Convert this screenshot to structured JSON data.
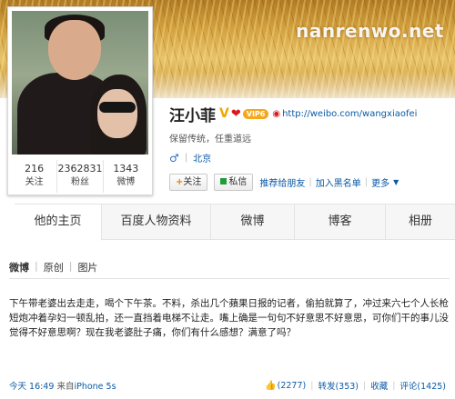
{
  "watermark": "nanrenwo.net",
  "profile": {
    "name": "汪小菲",
    "v_badge": "V",
    "heart_badge": "❤",
    "vip_badge": "VIP6",
    "weibo_url": "http://weibo.com/wangxiaofei",
    "bio": "保留传统，任重道远",
    "gender_symbol": "♂",
    "location": "北京"
  },
  "stats": [
    {
      "num": "216",
      "label": "关注"
    },
    {
      "num": "2362831",
      "label": "粉丝"
    },
    {
      "num": "1343",
      "label": "微博"
    }
  ],
  "actions": {
    "follow": "关注",
    "message": "私信",
    "recommend": "推荐给朋友",
    "blacklist": "加入黑名单",
    "more": "更多"
  },
  "tabs": [
    "他的主页",
    "百度人物资料",
    "微博",
    "博客",
    "相册"
  ],
  "subtabs": [
    "微博",
    "原创",
    "图片"
  ],
  "post": {
    "text": "下午带老婆出去走走，喝个下午茶。不料，杀出几个蘋果日报的记者，偷拍就算了，冲过来六七个人长枪短炮冲着孕妇一顿乱拍，还一直挡着电梯不让走。嘴上确是一句句不好意思不好意思，可你们干的事儿没觉得不好意思啊？现在我老婆肚子痛，你们有什么感想？满意了吗？",
    "time": "今天 16:49",
    "source_prefix": "来自",
    "source_device": "iPhone 5s",
    "likes": "(2277)",
    "repost": "转发(353)",
    "favorite": "收藏",
    "comment": "评论(1425)"
  }
}
